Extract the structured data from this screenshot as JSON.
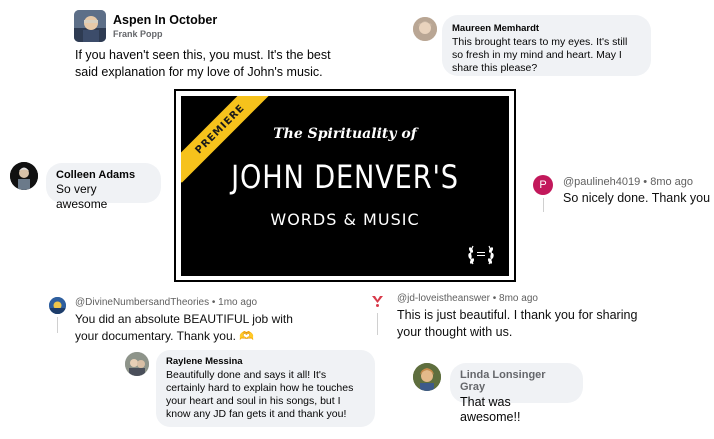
{
  "comments": {
    "aspen": {
      "name": "Aspen In October",
      "sub": "Frank Popp",
      "text": "If you haven't seen this, you must. It's the best said explanation for my love of John's music."
    },
    "maureen": {
      "name": "Maureen Memhardt",
      "text": "This brought tears to my eyes. It's still so fresh in my mind and heart. May I share this please?"
    },
    "colleen": {
      "name": "Colleen Adams",
      "text": "So very awesome"
    },
    "pauline": {
      "handle": "@paulineh4019",
      "time": "• 8mo ago",
      "avatar_letter": "P",
      "text": "So nicely done. Thank you"
    },
    "divine": {
      "handle": "@DivineNumbersandTheories",
      "time": "• 1mo ago",
      "text": "You did an absolute BEAUTIFUL job with your documentary. Thank you. 🫶"
    },
    "jd": {
      "handle": "@jd-loveistheanswer",
      "time": "• 8mo ago",
      "text": "This is just beautiful.  I thank you for sharing your thought with us."
    },
    "raylene": {
      "name": "Raylene Messina",
      "text": "Beautifully done and says it all!  It's certainly hard to explain how he touches your heart and soul in his songs, but I know any JD fan gets it and thank you!"
    },
    "linda": {
      "name": "Linda Lonsinger Gray",
      "text": "That was awesome!!"
    }
  },
  "poster": {
    "ribbon": "PREMIERE",
    "subtitle": "The Spirituality of",
    "title": "JOHN DENVER'S",
    "tagline": "WORDS & MUSIC"
  },
  "colors": {
    "bubble": "#f0f2f5",
    "ribbon": "#f6c21c",
    "pauline_avatar": "#c2185b"
  },
  "icons": [
    "aspen-avatar",
    "maureen-avatar",
    "colleen-avatar",
    "pauline-avatar",
    "divine-avatar",
    "jd-avatar",
    "raylene-avatar",
    "linda-avatar",
    "laurel-icon"
  ]
}
